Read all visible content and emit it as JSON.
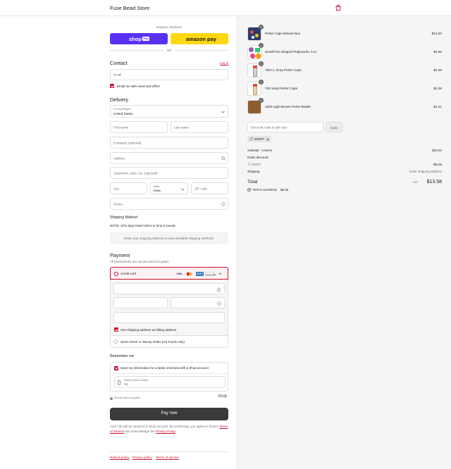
{
  "header": {
    "store_name": "Fuse Bead Store",
    "cart_icon": "bag-icon"
  },
  "express": {
    "label": "Express checkout",
    "shop_pay_label": "shop",
    "shop_pay_badge": "Pay",
    "amazon_pay_label": "amazon pay",
    "or_label": "OR"
  },
  "contact": {
    "title": "Contact",
    "login_label": "Log in",
    "email_placeholder": "Email",
    "news_label": "Email me with news and offers"
  },
  "delivery": {
    "title": "Delivery",
    "country_label": "Country/Region",
    "country_value": "United States",
    "first_name_placeholder": "First name",
    "last_name_placeholder": "Last name",
    "company_placeholder": "Company (optional)",
    "address_placeholder": "Address",
    "apartment_placeholder": "Apartment, suite, etc. (optional)",
    "city_placeholder": "City",
    "state_label": "State",
    "state_value": "Iowa",
    "zip_placeholder": "ZIP code",
    "phone_placeholder": "Phone"
  },
  "shipping": {
    "title": "Shipping Method",
    "note": "NOTE: UPS days listed refers to time in transit.",
    "message": "Enter your shipping address to view available shipping methods."
  },
  "payment": {
    "title": "Payment",
    "subtitle": "All transactions are secure and encrypted.",
    "credit_card_label": "Credit card",
    "card_logos": [
      "VISA",
      "MC",
      "AMEX",
      "DISCOVER"
    ],
    "more_label": "+4",
    "billing_label": "Use shipping address as billing address",
    "check_label": "Send Check or Money Order (US Funds only)"
  },
  "remember": {
    "title": "Remember me",
    "save_label": "Save my information for a faster checkout with a Shop account",
    "phone_label": "Mobile phone number",
    "phone_value": "+1",
    "secure_label": "Secure and encrypted",
    "shop_label": "shop"
  },
  "pay": {
    "button_label": "Pay now",
    "terms_prefix": "Your info will be saved to a Shop account. By continuing, you agree to Shop's",
    "terms_link": "Terms of Service",
    "terms_middle": "and acknowledge the",
    "privacy_link": "Privacy Policy",
    "terms_suffix": "."
  },
  "footer": {
    "links": [
      "Refund policy",
      "Privacy policy",
      "Terms of service"
    ]
  },
  "summary": {
    "items": [
      {
        "name": "Perler Caps Deluxe Box",
        "price": "$12.00",
        "qty": "1",
        "color": "#2a3b6e"
      },
      {
        "name": "Small Fun Shaped Pegboards, 5 ct.",
        "price": "$3.65",
        "qty": "1",
        "color": "#9b59b6"
      },
      {
        "name": "750 Lt. Gray Perler Caps",
        "price": "$2.39",
        "qty": "1",
        "color": "#c9c9c9"
      },
      {
        "name": "750 Sand Perler Caps",
        "price": "$2.39",
        "qty": "1",
        "color": "#e0c79e"
      },
      {
        "name": "1000 Light Brown Perler Beads",
        "price": "$2.21",
        "qty": "1",
        "color": "#8b5a2b"
      }
    ],
    "discount_placeholder": "Discount code or gift card",
    "apply_label": "Apply",
    "applied_code": "40OFF",
    "subtotal_label": "Subtotal · 5 items",
    "subtotal_value": "$22.64",
    "order_discount_label": "Order discount",
    "discount_code_label": "40OFF",
    "discount_value": "−$9.06",
    "shipping_label": "Shipping",
    "shipping_value": "Enter shipping address",
    "total_label": "Total",
    "currency": "USD",
    "total_value": "$13.58",
    "savings_label": "TOTAL SAVINGS",
    "savings_value": "$9.06"
  },
  "colors": {
    "accent": "#c8102e",
    "shop_pay": "#5a31f4",
    "amazon": "#ffd814",
    "pay_button": "#3a3a3a"
  }
}
